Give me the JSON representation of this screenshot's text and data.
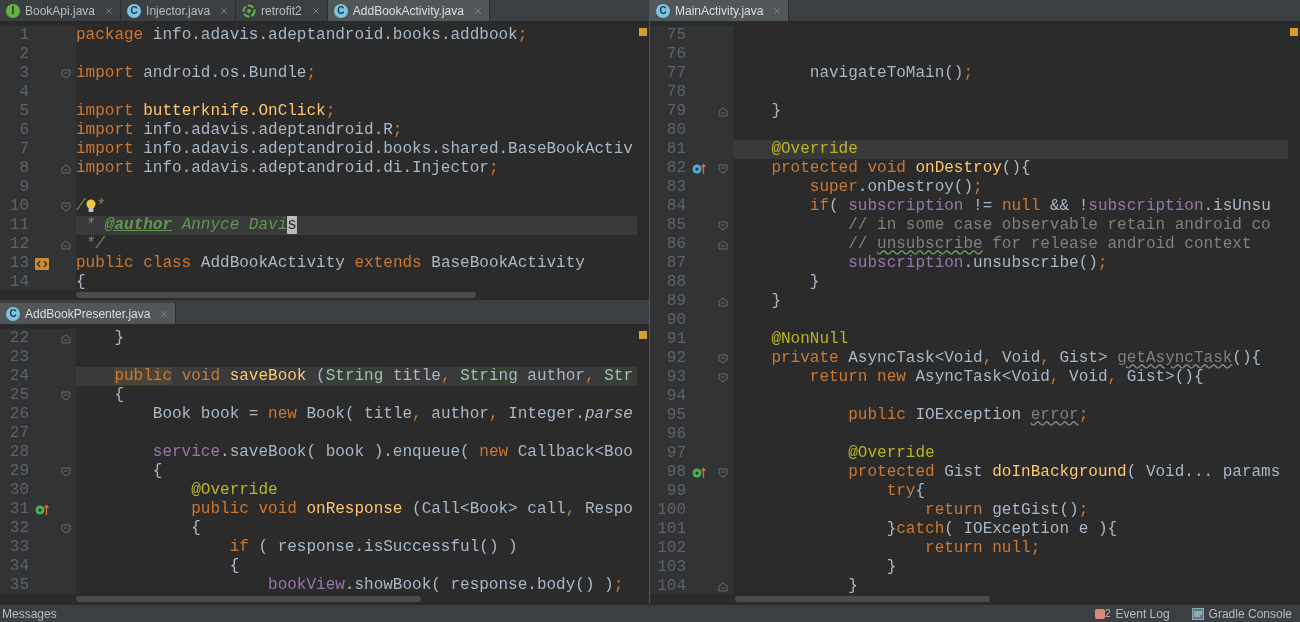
{
  "top_left_editor": {
    "tabs": [
      {
        "label": "BookApi.java",
        "kind": "interface",
        "icon_text": "I",
        "selected": false
      },
      {
        "label": "Injector.java",
        "kind": "class",
        "icon_text": "C",
        "selected": false
      },
      {
        "label": "retrofit2",
        "kind": "module",
        "selected": false
      },
      {
        "label": "AddBookActivity.java",
        "kind": "class",
        "icon_text": "C",
        "selected": true
      }
    ],
    "lines": [
      {
        "number": "1",
        "current": false,
        "tokens": [
          {
            "kind": "kw",
            "text": "package"
          },
          {
            "kind": "p",
            "text": " info.adavis.adeptandroid.books.addbook"
          },
          {
            "kind": "kw",
            "text": ";"
          }
        ]
      },
      {
        "number": "2"
      },
      {
        "number": "3",
        "current": false,
        "markers": [
          {
            "kind": "fold-start"
          }
        ],
        "tokens": [
          {
            "kind": "kw",
            "text": "import"
          },
          {
            "kind": "p",
            "text": " android.os.Bundle"
          },
          {
            "kind": "kw",
            "text": ";"
          }
        ]
      },
      {
        "number": "4"
      },
      {
        "number": "5",
        "current": false,
        "tokens": [
          {
            "kind": "kw",
            "text": "import"
          },
          {
            "kind": "decl",
            "text": " butterknife.OnClick"
          },
          {
            "kind": "kw",
            "text": ";"
          }
        ]
      },
      {
        "number": "6",
        "current": false,
        "tokens": [
          {
            "kind": "kw",
            "text": "import"
          },
          {
            "kind": "p",
            "text": " info.adavis.adeptandroid.R"
          },
          {
            "kind": "kw",
            "text": ";"
          }
        ]
      },
      {
        "number": "7",
        "current": false,
        "tokens": [
          {
            "kind": "kw",
            "text": "import"
          },
          {
            "kind": "p",
            "text": " info.adavis.adeptandroid.books.shared.BaseBookActiv"
          }
        ]
      },
      {
        "number": "8",
        "current": false,
        "markers": [
          {
            "kind": "fold-end"
          }
        ],
        "tokens": [
          {
            "kind": "kw",
            "text": "import"
          },
          {
            "kind": "p",
            "text": " info.adavis.adeptandroid.di.Injector"
          },
          {
            "kind": "kw",
            "text": ";"
          }
        ]
      },
      {
        "number": "9"
      },
      {
        "number": "10",
        "current": false,
        "markers": [
          {
            "kind": "fold-start"
          }
        ],
        "tokens": [
          {
            "kind": "doc",
            "text": "/"
          },
          {
            "kind": "bulb"
          },
          {
            "kind": "doc",
            "text": "*"
          }
        ]
      },
      {
        "number": "11",
        "current": true,
        "tokens": [
          {
            "kind": "doc",
            "text": " *"
          },
          {
            "kind": "doctag",
            "text": " @author"
          },
          {
            "kind": "doc",
            "text": " Annyce Davi"
          },
          {
            "kind": "caret",
            "text": "s"
          }
        ]
      },
      {
        "number": "12",
        "current": false,
        "markers": [
          {
            "kind": "fold-end"
          }
        ],
        "tokens": [
          {
            "kind": "doc",
            "text": " */"
          }
        ]
      },
      {
        "number": "13",
        "current": false,
        "markers": [
          {
            "kind": "related-file"
          }
        ],
        "tokens": [
          {
            "kind": "kw",
            "text": "public class"
          },
          {
            "kind": "p",
            "text": " AddBookActivity"
          },
          {
            "kind": "kw",
            "text": " extends"
          },
          {
            "kind": "p",
            "text": " BaseBookActivity"
          }
        ]
      },
      {
        "number": "14",
        "current": false,
        "tokens": [
          {
            "kind": "p",
            "text": "{"
          }
        ]
      }
    ]
  },
  "bottom_left_editor": {
    "tabs": [
      {
        "label": "AddBookPresenter.java",
        "kind": "class",
        "icon_text": "C",
        "selected": true
      }
    ],
    "lines": [
      {
        "number": "22",
        "current": false,
        "markers": [
          {
            "kind": "fold-end"
          }
        ],
        "tokens": [
          {
            "kind": "p",
            "text": "    }"
          }
        ]
      },
      {
        "number": "23"
      },
      {
        "number": "24",
        "current": true,
        "tokens": [
          {
            "kind": "kwhl",
            "text": "    public"
          },
          {
            "kind": "kw",
            "text": " void"
          },
          {
            "kind": "decl",
            "text": " saveBook"
          },
          {
            "kind": "p",
            "text": " ("
          },
          {
            "kind": "hl",
            "text": "String"
          },
          {
            "kind": "p",
            "text": " title"
          },
          {
            "kind": "kw",
            "text": ","
          },
          {
            "kind": "hl",
            "text": " String"
          },
          {
            "kind": "p",
            "text": " author"
          },
          {
            "kind": "kw",
            "text": ","
          },
          {
            "kind": "hl",
            "text": " Str"
          }
        ]
      },
      {
        "number": "25",
        "current": false,
        "markers": [
          {
            "kind": "fold-start"
          }
        ],
        "tokens": [
          {
            "kind": "p",
            "text": "    {"
          }
        ]
      },
      {
        "number": "26",
        "current": false,
        "tokens": [
          {
            "kind": "p",
            "text": "        Book book ="
          },
          {
            "kind": "kw",
            "text": " new"
          },
          {
            "kind": "p",
            "text": " Book( title"
          },
          {
            "kind": "kw",
            "text": ","
          },
          {
            "kind": "p",
            "text": " author"
          },
          {
            "kind": "kw",
            "text": ","
          },
          {
            "kind": "p",
            "text": " Integer."
          },
          {
            "kind": "italic",
            "text": "parse"
          }
        ]
      },
      {
        "number": "27"
      },
      {
        "number": "28",
        "current": false,
        "tokens": [
          {
            "kind": "field",
            "text": "        service"
          },
          {
            "kind": "p",
            "text": ".saveBook( book ).enqueue("
          },
          {
            "kind": "kw",
            "text": " new"
          },
          {
            "kind": "p",
            "text": " Callback<Boo"
          }
        ]
      },
      {
        "number": "29",
        "current": false,
        "markers": [
          {
            "kind": "fold-start"
          }
        ],
        "tokens": [
          {
            "kind": "p",
            "text": "        {"
          }
        ]
      },
      {
        "number": "30",
        "current": false,
        "tokens": [
          {
            "kind": "annot",
            "text": "            @Override"
          }
        ]
      },
      {
        "number": "31",
        "current": false,
        "markers": [
          {
            "kind": "implementing"
          }
        ],
        "tokens": [
          {
            "kind": "kw",
            "text": "            public void"
          },
          {
            "kind": "decl",
            "text": " onResponse"
          },
          {
            "kind": "p",
            "text": " (Call<Book> call"
          },
          {
            "kind": "kw",
            "text": ","
          },
          {
            "kind": "p",
            "text": " Respo"
          }
        ]
      },
      {
        "number": "32",
        "current": false,
        "markers": [
          {
            "kind": "fold-start"
          }
        ],
        "tokens": [
          {
            "kind": "p",
            "text": "            {"
          }
        ]
      },
      {
        "number": "33",
        "current": false,
        "tokens": [
          {
            "kind": "kw",
            "text": "                if"
          },
          {
            "kind": "p",
            "text": " ( response.isSuccessful() )"
          }
        ]
      },
      {
        "number": "34",
        "current": false,
        "tokens": [
          {
            "kind": "p",
            "text": "                {"
          }
        ]
      },
      {
        "number": "35",
        "current": false,
        "tokens": [
          {
            "kind": "field",
            "text": "                    bookView"
          },
          {
            "kind": "p",
            "text": ".showBook( response.body() )"
          },
          {
            "kind": "kw",
            "text": ";"
          }
        ]
      }
    ]
  },
  "right_editor": {
    "tabs": [
      {
        "label": "MainActivity.java",
        "kind": "class",
        "icon_text": "C",
        "selected": true
      }
    ],
    "lines": [
      {
        "number": "75"
      },
      {
        "number": "76"
      },
      {
        "number": "77",
        "current": false,
        "tokens": [
          {
            "kind": "p",
            "text": "        navigateToMain()"
          },
          {
            "kind": "kw",
            "text": ";"
          }
        ]
      },
      {
        "number": "78"
      },
      {
        "number": "79",
        "current": false,
        "markers": [
          {
            "kind": "fold-end"
          }
        ],
        "tokens": [
          {
            "kind": "p",
            "text": "    }"
          }
        ]
      },
      {
        "number": "80"
      },
      {
        "number": "81",
        "current": true,
        "tokens": [
          {
            "kind": "annot",
            "text": "    @Override"
          }
        ]
      },
      {
        "number": "82",
        "current": false,
        "markers": [
          {
            "kind": "overriding"
          },
          {
            "kind": "fold-start"
          }
        ],
        "tokens": [
          {
            "kind": "kw",
            "text": "    protected void"
          },
          {
            "kind": "decl",
            "text": " onDestroy"
          },
          {
            "kind": "p",
            "text": "(){"
          }
        ]
      },
      {
        "number": "83",
        "current": false,
        "tokens": [
          {
            "kind": "kw",
            "text": "        super"
          },
          {
            "kind": "p",
            "text": ".onDestroy()"
          },
          {
            "kind": "kw",
            "text": ";"
          }
        ]
      },
      {
        "number": "84",
        "current": false,
        "tokens": [
          {
            "kind": "kw",
            "text": "        if"
          },
          {
            "kind": "p",
            "text": "("
          },
          {
            "kind": "field",
            "text": " subscription"
          },
          {
            "kind": "p",
            "text": " !="
          },
          {
            "kind": "kw",
            "text": " null"
          },
          {
            "kind": "p",
            "text": " && !"
          },
          {
            "kind": "field",
            "text": "subscription"
          },
          {
            "kind": "p",
            "text": ".isUnsu"
          }
        ]
      },
      {
        "number": "85",
        "current": false,
        "markers": [
          {
            "kind": "fold-start"
          }
        ],
        "tokens": [
          {
            "kind": "comment",
            "text": "            // in some case observable retain android co"
          }
        ]
      },
      {
        "number": "86",
        "current": false,
        "markers": [
          {
            "kind": "fold-end"
          }
        ],
        "tokens": [
          {
            "kind": "comment",
            "text": "            //"
          },
          {
            "kind": "typo",
            "text": " unsubscribe"
          },
          {
            "kind": "comment",
            "text": " for release android context"
          }
        ]
      },
      {
        "number": "87",
        "current": false,
        "tokens": [
          {
            "kind": "field",
            "text": "            subscription"
          },
          {
            "kind": "p",
            "text": ".unsubscribe()"
          },
          {
            "kind": "kw",
            "text": ";"
          }
        ]
      },
      {
        "number": "88",
        "current": false,
        "tokens": [
          {
            "kind": "p",
            "text": "        }"
          }
        ]
      },
      {
        "number": "89",
        "current": false,
        "markers": [
          {
            "kind": "fold-end"
          }
        ],
        "tokens": [
          {
            "kind": "p",
            "text": "    }"
          }
        ]
      },
      {
        "number": "90"
      },
      {
        "number": "91",
        "current": false,
        "tokens": [
          {
            "kind": "annot",
            "text": "    @NonNull"
          }
        ]
      },
      {
        "number": "92",
        "current": false,
        "markers": [
          {
            "kind": "fold-start"
          }
        ],
        "tokens": [
          {
            "kind": "kw",
            "text": "    private"
          },
          {
            "kind": "p",
            "text": " AsyncTask<Void"
          },
          {
            "kind": "kw",
            "text": ","
          },
          {
            "kind": "p",
            "text": " Void"
          },
          {
            "kind": "kw",
            "text": ","
          },
          {
            "kind": "p",
            "text": " Gist>"
          },
          {
            "kind": "unused",
            "text": " getAsyncTask"
          },
          {
            "kind": "p",
            "text": "(){"
          }
        ]
      },
      {
        "number": "93",
        "current": false,
        "markers": [
          {
            "kind": "fold-start"
          }
        ],
        "tokens": [
          {
            "kind": "kw",
            "text": "        return new"
          },
          {
            "kind": "p",
            "text": " AsyncTask<Void"
          },
          {
            "kind": "kw",
            "text": ","
          },
          {
            "kind": "p",
            "text": " Void"
          },
          {
            "kind": "kw",
            "text": ","
          },
          {
            "kind": "p",
            "text": " Gist>(){"
          }
        ]
      },
      {
        "number": "94"
      },
      {
        "number": "95",
        "current": false,
        "tokens": [
          {
            "kind": "kw",
            "text": "            public"
          },
          {
            "kind": "p",
            "text": " IOException"
          },
          {
            "kind": "unused",
            "text": " error"
          },
          {
            "kind": "kw",
            "text": ";"
          }
        ]
      },
      {
        "number": "96"
      },
      {
        "number": "97",
        "current": false,
        "tokens": [
          {
            "kind": "annot",
            "text": "            @Override"
          }
        ]
      },
      {
        "number": "98",
        "current": false,
        "markers": [
          {
            "kind": "implementing"
          },
          {
            "kind": "fold-start"
          }
        ],
        "tokens": [
          {
            "kind": "kw",
            "text": "            protected"
          },
          {
            "kind": "p",
            "text": " Gist"
          },
          {
            "kind": "decl",
            "text": " doInBackground"
          },
          {
            "kind": "p",
            "text": "( Void... params"
          }
        ]
      },
      {
        "number": "99",
        "current": false,
        "tokens": [
          {
            "kind": "kw",
            "text": "                try"
          },
          {
            "kind": "p",
            "text": "{"
          }
        ]
      },
      {
        "number": "100",
        "current": false,
        "tokens": [
          {
            "kind": "kw",
            "text": "                    return"
          },
          {
            "kind": "p",
            "text": " getGist()"
          },
          {
            "kind": "kw",
            "text": ";"
          }
        ]
      },
      {
        "number": "101",
        "current": false,
        "tokens": [
          {
            "kind": "p",
            "text": "                }"
          },
          {
            "kind": "kw",
            "text": "catch"
          },
          {
            "kind": "p",
            "text": "( IOException e ){"
          }
        ]
      },
      {
        "number": "102",
        "current": false,
        "tokens": [
          {
            "kind": "kw",
            "text": "                    return null;"
          }
        ]
      },
      {
        "number": "103",
        "current": false,
        "tokens": [
          {
            "kind": "p",
            "text": "                }"
          }
        ]
      },
      {
        "number": "104",
        "current": false,
        "markers": [
          {
            "kind": "fold-end"
          }
        ],
        "tokens": [
          {
            "kind": "p",
            "text": "            }"
          }
        ]
      }
    ]
  },
  "status_bar": {
    "messages": "Messages",
    "event_log": {
      "label": "Event Log",
      "count": "2"
    },
    "gradle_console": "Gradle Console"
  }
}
